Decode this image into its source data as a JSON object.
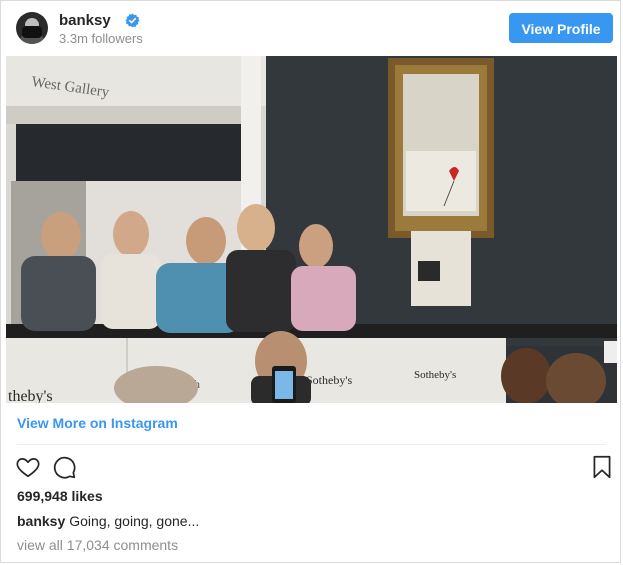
{
  "header": {
    "username": "banksy",
    "followers": "3.3m followers",
    "view_profile_label": "View Profile",
    "verified_icon": "verified-badge-icon",
    "accent_color": "#3897f0"
  },
  "photo": {
    "sign_text": "West Gallery",
    "podium_text_left": "theby's",
    "podium_text_mid": "Sotheby's",
    "podium_text_right": "Sotheby's",
    "podium_text_partial": "Soth"
  },
  "view_more_label": "View More on Instagram",
  "actions": {
    "like_icon": "heart-icon",
    "comment_icon": "comment-icon",
    "save_icon": "bookmark-icon"
  },
  "likes": "699,948 likes",
  "caption": {
    "username": "banksy",
    "text": "Going, going, gone..."
  },
  "comments_link": "view all 17,034 comments"
}
